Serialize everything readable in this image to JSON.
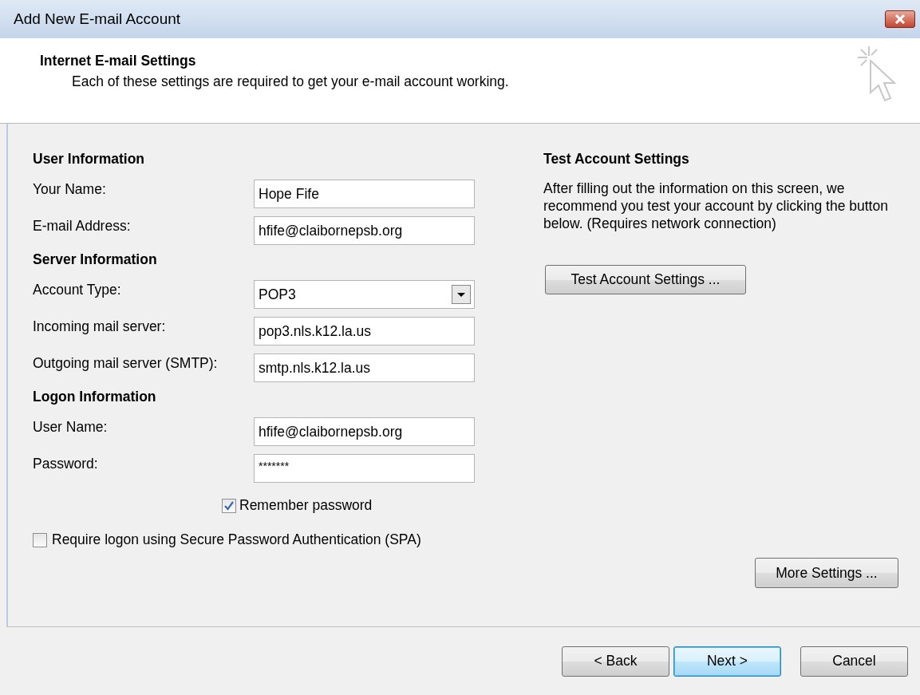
{
  "window": {
    "title": "Add New E-mail Account"
  },
  "header": {
    "title": "Internet E-mail Settings",
    "subtitle": "Each of these settings are required to get your e-mail account working."
  },
  "sections": [
    {
      "title": "User Information",
      "fields": [
        {
          "label": "Your Name:",
          "kind": "text",
          "value": "Hope Fife"
        },
        {
          "label": "E-mail Address:",
          "kind": "text",
          "value": "hfife@claibornepsb.org"
        }
      ]
    },
    {
      "title": "Server Information",
      "fields": [
        {
          "label": "Account Type:",
          "kind": "dropdown",
          "value": "POP3"
        },
        {
          "label": "Incoming mail server:",
          "kind": "text",
          "value": "pop3.nls.k12.la.us"
        },
        {
          "label": "Outgoing mail server (SMTP):",
          "kind": "text",
          "value": "smtp.nls.k12.la.us"
        }
      ]
    },
    {
      "title": "Logon Information",
      "fields": [
        {
          "label": "User Name:",
          "kind": "text",
          "value": "hfife@claibornepsb.org"
        },
        {
          "label": "Password:",
          "kind": "password",
          "value": "*******"
        }
      ]
    }
  ],
  "remember_password": {
    "label": "Remember password",
    "checked": true
  },
  "require_spa": {
    "label": "Require logon using Secure Password Authentication (SPA)",
    "checked": false
  },
  "test": {
    "title": "Test Account Settings",
    "text": "After filling out the information on this screen, we recommend you test your account by clicking the button below. (Requires network connection)",
    "button": "Test Account Settings ..."
  },
  "more_settings": "More Settings ...",
  "footer_buttons": [
    {
      "label": "< Back",
      "default": false
    },
    {
      "label": "Next >",
      "default": true
    },
    {
      "label": "Cancel",
      "default": false
    }
  ]
}
